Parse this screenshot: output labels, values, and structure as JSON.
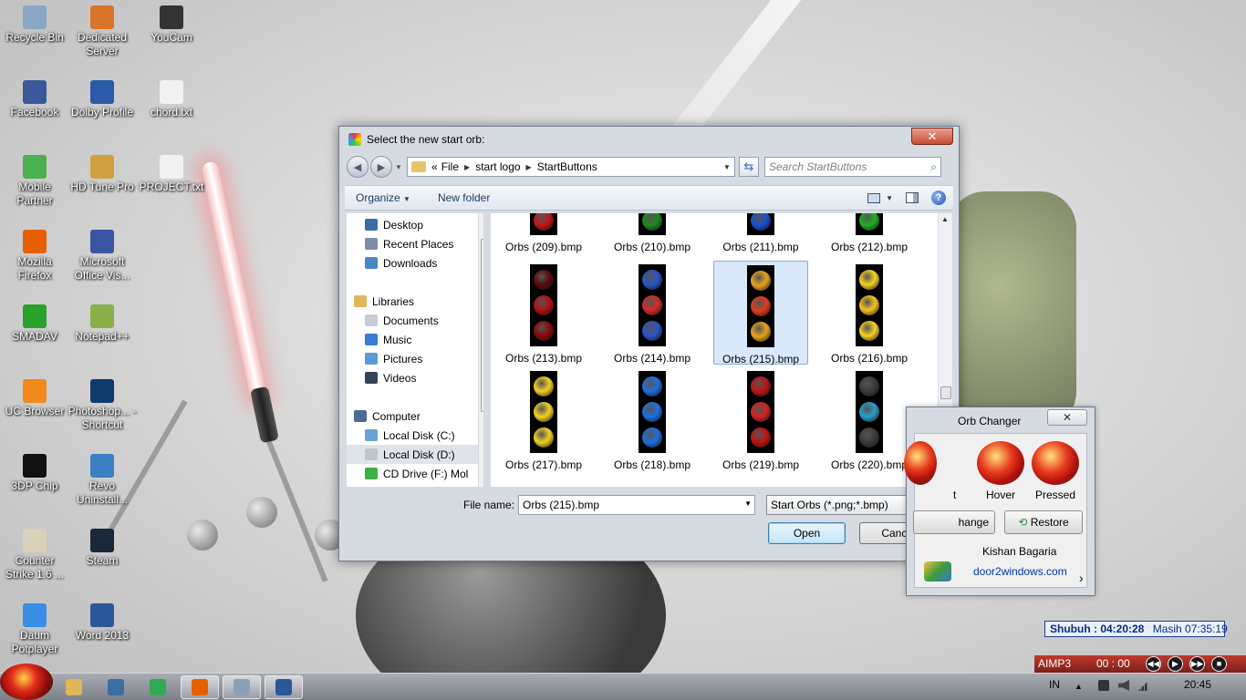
{
  "desktop": {
    "icons": [
      {
        "label": "Recycle Bin",
        "icon": "recycle-bin-icon",
        "color": "#8aa7c4"
      },
      {
        "label": "Dedicated Server",
        "icon": "half-life-icon",
        "color": "#d9742b"
      },
      {
        "label": "YouCam",
        "icon": "youcam-icon",
        "color": "#333333"
      },
      {
        "label": "Facebook",
        "icon": "facebook-icon",
        "color": "#3b5998"
      },
      {
        "label": "Dolby Profile",
        "icon": "dolby-icon",
        "color": "#2a5aa8"
      },
      {
        "label": "chord.txt",
        "icon": "text-file-icon",
        "color": "#f2f2f2"
      },
      {
        "label": "Mobile Partner",
        "icon": "mobile-partner-icon",
        "color": "#4caf50"
      },
      {
        "label": "HD Tune Pro",
        "icon": "hd-tune-icon",
        "color": "#d0a040"
      },
      {
        "label": "PROJECT.txt",
        "icon": "text-file-icon",
        "color": "#f2f2f2"
      },
      {
        "label": "Mozilla Firefox",
        "icon": "firefox-icon",
        "color": "#e66000"
      },
      {
        "label": "Microsoft Office Vis...",
        "icon": "visio-icon",
        "color": "#3955a3"
      },
      {
        "label": "SMADAV",
        "icon": "smadav-icon",
        "color": "#2aa12a"
      },
      {
        "label": "Notepad++",
        "icon": "notepadpp-icon",
        "color": "#8ab04a"
      },
      {
        "label": "UC Browser",
        "icon": "uc-browser-icon",
        "color": "#f08a1c"
      },
      {
        "label": "Photoshop... - Shortcut",
        "icon": "photoshop-icon",
        "color": "#0f3a6b"
      },
      {
        "label": "3DP Chip",
        "icon": "3dp-chip-icon",
        "color": "#111111"
      },
      {
        "label": "Revo Uninstall...",
        "icon": "revo-icon",
        "color": "#3b7fc4"
      },
      {
        "label": "Counter Strike 1.6 ...",
        "icon": "counter-strike-icon",
        "color": "#d9d2b8"
      },
      {
        "label": "Steam",
        "icon": "steam-icon",
        "color": "#1b2838"
      },
      {
        "label": "Daum Potplayer",
        "icon": "potplayer-icon",
        "color": "#3a8ee6"
      },
      {
        "label": "Word 2013",
        "icon": "word-icon",
        "color": "#2b579a"
      }
    ]
  },
  "dialog": {
    "title": "Select the new start orb:",
    "close_label": "✕",
    "breadcrumb": {
      "overflow": "«",
      "segments": [
        "File",
        "start logo",
        "StartButtons"
      ]
    },
    "search_placeholder": "Search StartButtons",
    "toolbar": {
      "organize": "Organize",
      "new_folder": "New folder",
      "help": "?"
    },
    "nav": [
      {
        "label": "Desktop",
        "icon": "desktop-icon",
        "color": "#3a6ea5"
      },
      {
        "label": "Recent Places",
        "icon": "recent-places-icon",
        "color": "#7d8fa6"
      },
      {
        "label": "Downloads",
        "icon": "downloads-icon",
        "color": "#4a86c9"
      },
      {
        "label": "Libraries",
        "icon": "libraries-icon",
        "color": "#e0b659"
      },
      {
        "label": "Documents",
        "icon": "documents-icon",
        "color": "#c7cdd5"
      },
      {
        "label": "Music",
        "icon": "music-icon",
        "color": "#3a7bd5"
      },
      {
        "label": "Pictures",
        "icon": "pictures-icon",
        "color": "#5b9bd5"
      },
      {
        "label": "Videos",
        "icon": "videos-icon",
        "color": "#345"
      },
      {
        "label": "Computer",
        "icon": "computer-icon",
        "color": "#4a6b93"
      },
      {
        "label": "Local Disk (C:)",
        "icon": "windows-drive-icon",
        "color": "#6aa2d8"
      },
      {
        "label": "Local Disk (D:)",
        "icon": "drive-icon",
        "color": "#bfc4ca"
      },
      {
        "label": "CD Drive (F:) Mol",
        "icon": "cd-drive-icon",
        "color": "#3cb043"
      }
    ],
    "files": [
      {
        "name": "Orbs (209).bmp",
        "colors": [
          "#c0171a"
        ]
      },
      {
        "name": "Orbs (210).bmp",
        "colors": [
          "#1c8a1c"
        ]
      },
      {
        "name": "Orbs (211).bmp",
        "colors": [
          "#1a4fd1"
        ]
      },
      {
        "name": "Orbs (212).bmp",
        "colors": [
          "#20b020"
        ]
      },
      {
        "name": "Orbs (213).bmp",
        "colors": [
          "#5a0a0a",
          "#b01010",
          "#8a0808"
        ]
      },
      {
        "name": "Orbs (214).bmp",
        "colors": [
          "#2a55c8",
          "#d42a2a",
          "#2a55c8"
        ]
      },
      {
        "name": "Orbs (215).bmp",
        "colors": [
          "#e8a21a",
          "#e23b1d",
          "#e8a21a"
        ]
      },
      {
        "name": "Orbs (216).bmp",
        "colors": [
          "#f7d21e",
          "#f7c21e",
          "#f7d21e"
        ]
      },
      {
        "name": "Orbs (217).bmp",
        "colors": [
          "#f3d024",
          "#f3d024",
          "#f3d024"
        ]
      },
      {
        "name": "Orbs (218).bmp",
        "colors": [
          "#1f6fe0",
          "#1f6fe0",
          "#1f6fe0"
        ]
      },
      {
        "name": "Orbs (219).bmp",
        "colors": [
          "#c01212",
          "#d42222",
          "#c01212"
        ]
      },
      {
        "name": "Orbs (220).bmp",
        "colors": [
          "#3b3b3b",
          "#26a0c8",
          "#3b3b3b"
        ]
      }
    ],
    "filename_label": "File name:",
    "filename_value": "Orbs (215).bmp",
    "filetype_value": "Start Orbs (*.png;*.bmp)",
    "open_label": "Open",
    "cancel_label": "Cancel"
  },
  "orb_changer": {
    "title": "Orb Changer",
    "close_label": "✕",
    "label_normal": "t",
    "label_hover": "Hover",
    "label_pressed": "Pressed",
    "change_label": "hange",
    "restore_label": "Restore",
    "author": "Kishan Bagaria",
    "link": "door2windows.com",
    "chevron": "›"
  },
  "prayer": {
    "label": "Shubuh : 04:20:28",
    "remaining": "Masih 07:35:19"
  },
  "aimp": {
    "name": "AIMP3",
    "time": "00 : 00",
    "prev": "◀◀",
    "play": "▶",
    "next": "▶▶",
    "stop": "■"
  },
  "taskbar": {
    "apps": [
      {
        "icon": "explorer-icon",
        "color": "#e0b659"
      },
      {
        "icon": "window-switcher-icon",
        "color": "#3a6ea5"
      },
      {
        "icon": "chrome-icon",
        "color": "#34a853"
      },
      {
        "icon": "firefox-icon",
        "color": "#e66000"
      },
      {
        "icon": "orb-changer-icon",
        "color": "#8aa0b8"
      },
      {
        "icon": "word-icon",
        "color": "#2b579a"
      }
    ],
    "language": "IN",
    "clock": "20:45",
    "tray_up": "▲"
  }
}
